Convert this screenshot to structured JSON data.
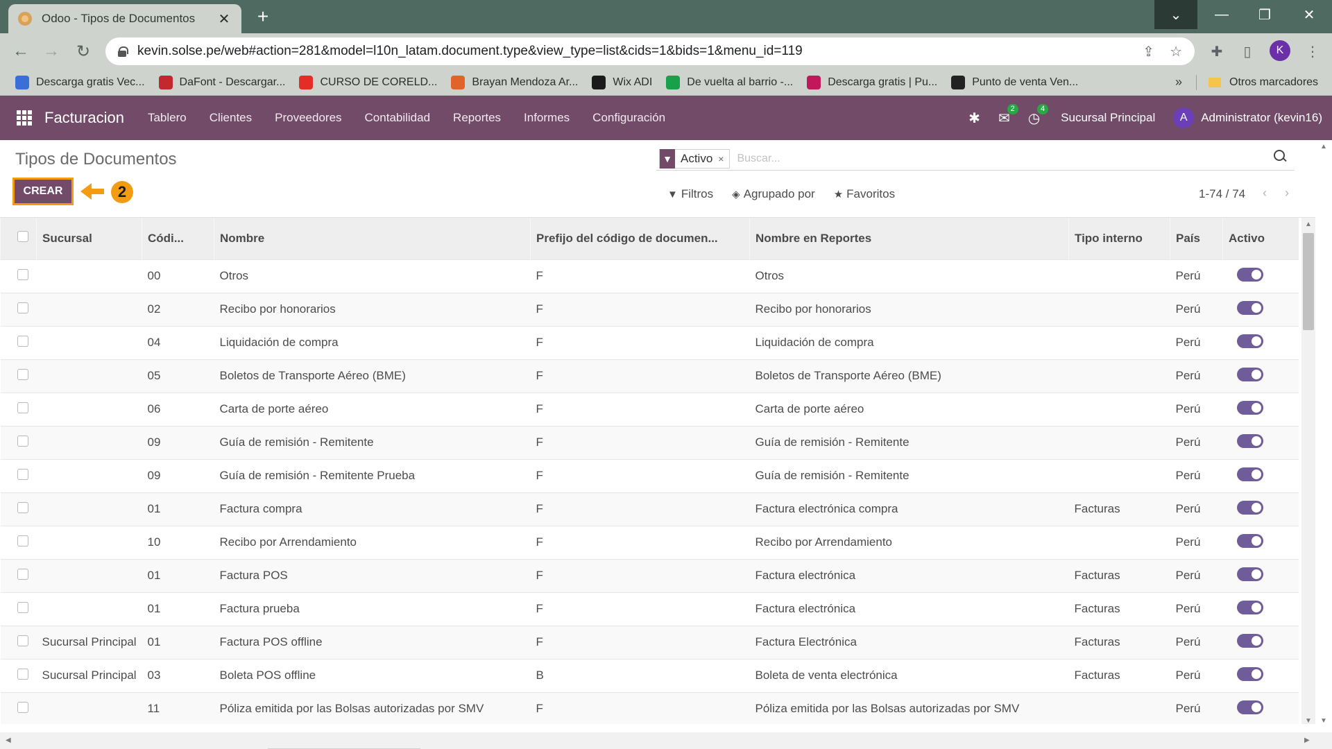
{
  "browser": {
    "tab_title": "Odoo - Tipos de Documentos",
    "tab_close": "✕",
    "new_tab": "+",
    "url": "kevin.solse.pe/web#action=281&model=l10n_latam.document.type&view_type=list&cids=1&bids=1&menu_id=119",
    "profile_initial": "K",
    "bookmarks": [
      {
        "label": "Descarga gratis Vec...",
        "color": "#3b6fd8"
      },
      {
        "label": "DaFont - Descargar...",
        "color": "#c4282f"
      },
      {
        "label": "CURSO DE CORELD...",
        "color": "#e52d27"
      },
      {
        "label": "Brayan Mendoza Ar...",
        "color": "#e2632a"
      },
      {
        "label": "Wix ADI",
        "color": "#1a1a1a"
      },
      {
        "label": "De vuelta al barrio -...",
        "color": "#19a04a"
      },
      {
        "label": "Descarga gratis | Pu...",
        "color": "#c2185b"
      },
      {
        "label": "Punto de venta Ven...",
        "color": "#222222"
      }
    ],
    "bookmarks_more": "»",
    "other_bookmarks": "Otros marcadores"
  },
  "odoo_nav": {
    "brand": "Facturacion",
    "menu": [
      "Tablero",
      "Clientes",
      "Proveedores",
      "Contabilidad",
      "Reportes",
      "Informes",
      "Configuración"
    ],
    "messages_count": "2",
    "activities_count": "4",
    "company": "Sucursal Principal",
    "avatar_initial": "A",
    "user": "Administrator (kevin16)"
  },
  "control_panel": {
    "breadcrumb": "Tipos de Documentos",
    "create_label": "CREAR",
    "step_number": "2",
    "facet_value": "Activo",
    "facet_remove": "×",
    "search_placeholder": "Buscar...",
    "filters_label": "Filtros",
    "groupby_label": "Agrupado por",
    "favorites_label": "Favoritos",
    "pager": "1-74 / 74"
  },
  "table": {
    "columns": [
      "Sucursal",
      "Códi...",
      "Nombre",
      "Prefijo del código de documen...",
      "Nombre en Reportes",
      "Tipo interno",
      "País",
      "Activo"
    ],
    "rows": [
      {
        "sucursal": "",
        "codigo": "00",
        "nombre": "Otros",
        "prefijo": "F",
        "reporte": "Otros",
        "tipo": "",
        "pais": "Perú",
        "activo": true
      },
      {
        "sucursal": "",
        "codigo": "02",
        "nombre": "Recibo por honorarios",
        "prefijo": "F",
        "reporte": "Recibo por honorarios",
        "tipo": "",
        "pais": "Perú",
        "activo": true
      },
      {
        "sucursal": "",
        "codigo": "04",
        "nombre": "Liquidación de compra",
        "prefijo": "F",
        "reporte": "Liquidación de compra",
        "tipo": "",
        "pais": "Perú",
        "activo": true
      },
      {
        "sucursal": "",
        "codigo": "05",
        "nombre": "Boletos de Transporte Aéreo (BME)",
        "prefijo": "F",
        "reporte": "Boletos de Transporte Aéreo (BME)",
        "tipo": "",
        "pais": "Perú",
        "activo": true
      },
      {
        "sucursal": "",
        "codigo": "06",
        "nombre": "Carta de porte aéreo",
        "prefijo": "F",
        "reporte": "Carta de porte aéreo",
        "tipo": "",
        "pais": "Perú",
        "activo": true
      },
      {
        "sucursal": "",
        "codigo": "09",
        "nombre": "Guía de remisión - Remitente",
        "prefijo": "F",
        "reporte": "Guía de remisión - Remitente",
        "tipo": "",
        "pais": "Perú",
        "activo": true
      },
      {
        "sucursal": "",
        "codigo": "09",
        "nombre": "Guía de remisión - Remitente Prueba",
        "prefijo": "F",
        "reporte": "Guía de remisión - Remitente",
        "tipo": "",
        "pais": "Perú",
        "activo": true
      },
      {
        "sucursal": "",
        "codigo": "01",
        "nombre": "Factura compra",
        "prefijo": "F",
        "reporte": "Factura electrónica compra",
        "tipo": "Facturas",
        "pais": "Perú",
        "activo": true
      },
      {
        "sucursal": "",
        "codigo": "10",
        "nombre": "Recibo por Arrendamiento",
        "prefijo": "F",
        "reporte": "Recibo por Arrendamiento",
        "tipo": "",
        "pais": "Perú",
        "activo": true
      },
      {
        "sucursal": "",
        "codigo": "01",
        "nombre": "Factura POS",
        "prefijo": "F",
        "reporte": "Factura electrónica",
        "tipo": "Facturas",
        "pais": "Perú",
        "activo": true
      },
      {
        "sucursal": "",
        "codigo": "01",
        "nombre": "Factura prueba",
        "prefijo": "F",
        "reporte": "Factura electrónica",
        "tipo": "Facturas",
        "pais": "Perú",
        "activo": true
      },
      {
        "sucursal": "Sucursal Principal",
        "codigo": "01",
        "nombre": "Factura POS offline",
        "prefijo": "F",
        "reporte": "Factura Electrónica",
        "tipo": "Facturas",
        "pais": "Perú",
        "activo": true
      },
      {
        "sucursal": "Sucursal Principal",
        "codigo": "03",
        "nombre": "Boleta POS offline",
        "prefijo": "B",
        "reporte": "Boleta de venta electrónica",
        "tipo": "Facturas",
        "pais": "Perú",
        "activo": true
      },
      {
        "sucursal": "",
        "codigo": "11",
        "nombre": "Póliza emitida por las Bolsas autorizadas por SMV",
        "prefijo": "F",
        "reporte": "Póliza emitida por las Bolsas autorizadas por SMV",
        "tipo": "",
        "pais": "Perú",
        "activo": true
      }
    ]
  },
  "colors": {
    "odoo_primary": "#714b67",
    "toggle_on": "#6f5c98",
    "highlight": "#f39c12",
    "browser_frame": "#4f6a60"
  }
}
